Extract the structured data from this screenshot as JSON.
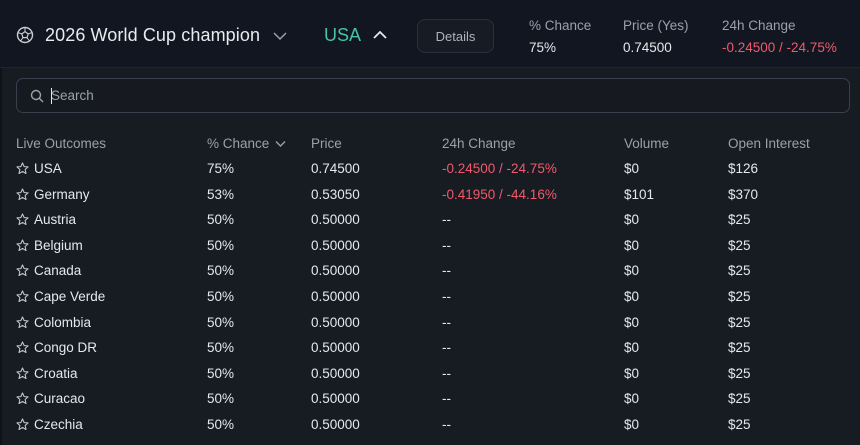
{
  "header": {
    "market_icon": "soccer-ball-icon",
    "title": "2026 World Cup champion",
    "selected_outcome": "USA",
    "details_label": "Details",
    "stats": [
      {
        "label": "% Chance",
        "value": "75%",
        "negative": false
      },
      {
        "label": "Price (Yes)",
        "value": "0.74500",
        "negative": false
      },
      {
        "label": "24h Change",
        "value": "-0.24500 / -24.75%",
        "negative": true
      }
    ]
  },
  "search": {
    "placeholder": "Search",
    "icon": "search-icon"
  },
  "table": {
    "columns": [
      "Live Outcomes",
      "% Chance",
      "Price",
      "24h Change",
      "Volume",
      "Open Interest"
    ],
    "sorted_column_icon": "chevron-down-icon",
    "rows": [
      {
        "name": "USA",
        "chance": "75%",
        "price": "0.74500",
        "change": "-0.24500 / -24.75%",
        "volume": "$0",
        "oi": "$126"
      },
      {
        "name": "Germany",
        "chance": "53%",
        "price": "0.53050",
        "change": "-0.41950 / -44.16%",
        "volume": "$101",
        "oi": "$370"
      },
      {
        "name": "Austria",
        "chance": "50%",
        "price": "0.50000",
        "change": "--",
        "volume": "$0",
        "oi": "$25"
      },
      {
        "name": "Belgium",
        "chance": "50%",
        "price": "0.50000",
        "change": "--",
        "volume": "$0",
        "oi": "$25"
      },
      {
        "name": "Canada",
        "chance": "50%",
        "price": "0.50000",
        "change": "--",
        "volume": "$0",
        "oi": "$25"
      },
      {
        "name": "Cape Verde",
        "chance": "50%",
        "price": "0.50000",
        "change": "--",
        "volume": "$0",
        "oi": "$25"
      },
      {
        "name": "Colombia",
        "chance": "50%",
        "price": "0.50000",
        "change": "--",
        "volume": "$0",
        "oi": "$25"
      },
      {
        "name": "Congo DR",
        "chance": "50%",
        "price": "0.50000",
        "change": "--",
        "volume": "$0",
        "oi": "$25"
      },
      {
        "name": "Croatia",
        "chance": "50%",
        "price": "0.50000",
        "change": "--",
        "volume": "$0",
        "oi": "$25"
      },
      {
        "name": "Curacao",
        "chance": "50%",
        "price": "0.50000",
        "change": "--",
        "volume": "$0",
        "oi": "$25"
      },
      {
        "name": "Czechia",
        "chance": "50%",
        "price": "0.50000",
        "change": "--",
        "volume": "$0",
        "oi": "$25"
      }
    ]
  },
  "colors": {
    "accent": "#48c2a9",
    "negative": "#f05a6b",
    "muted": "#9aa1ab"
  }
}
